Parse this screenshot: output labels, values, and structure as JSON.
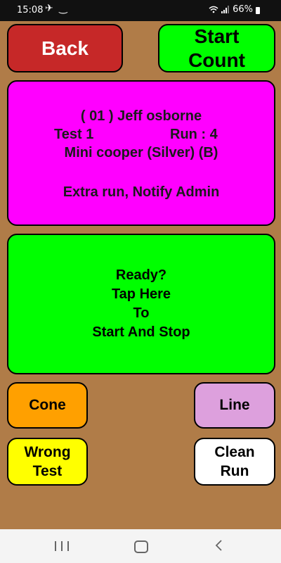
{
  "status_bar": {
    "time": "15:08",
    "left_icons": [
      "airplane-icon",
      "voicemail-icon"
    ],
    "battery": "66%",
    "right_icons": [
      "wifi-icon",
      "signal-icon",
      "battery-icon"
    ]
  },
  "top_buttons": {
    "back_label": "Back",
    "start_count_label": "Start\nCount"
  },
  "info": {
    "driver": "( 01 ) Jeff osborne",
    "test": "Test  1",
    "run": "Run :  4",
    "car": "Mini cooper (Silver) (B)",
    "notice": "Extra run, Notify Admin"
  },
  "tap_area": {
    "text": "Ready?\nTap Here\nTo\nStart And Stop"
  },
  "penalty_buttons": {
    "cone_label": "Cone",
    "line_label": "Line",
    "wrong_test_label": "Wrong\nTest",
    "clean_run_label": "Clean\nRun"
  },
  "nav_bar": {
    "icons": [
      "recent-apps-icon",
      "home-icon",
      "back-icon"
    ]
  },
  "colors": {
    "background": "#b07c48",
    "back": "#c62828",
    "start_count": "#00ff00",
    "info_panel": "#ff00ff",
    "tap_area": "#00ff00",
    "cone": "#ffa000",
    "line": "#dda0dd",
    "wrong_test": "#ffff00",
    "clean_run": "#ffffff"
  }
}
